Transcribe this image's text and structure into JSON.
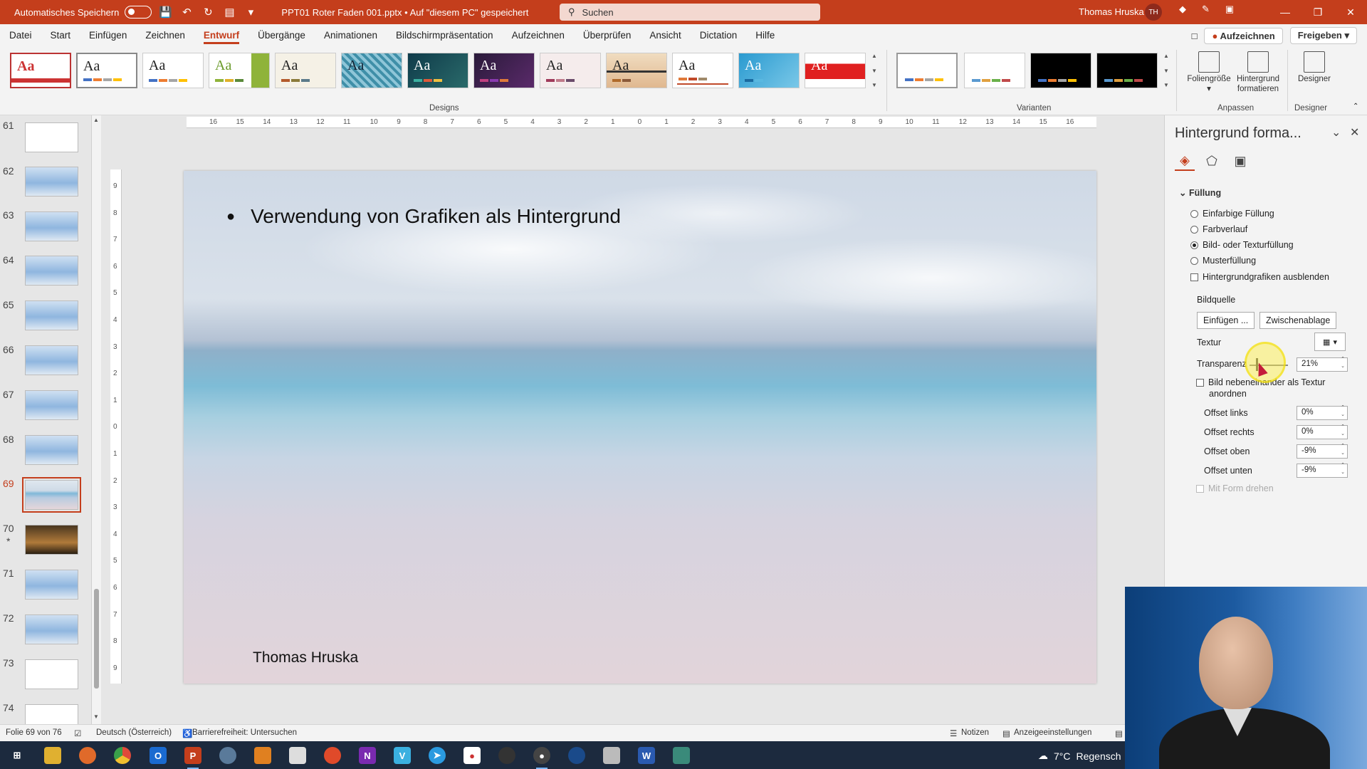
{
  "titlebar": {
    "autosave_label": "Automatisches Speichern",
    "doc_title": "PPT01 Roter Faden 001.pptx • Auf \"diesem PC\" gespeichert",
    "search_placeholder": "Suchen",
    "user_name": "Thomas Hruska",
    "user_initials": "TH"
  },
  "menu": {
    "tabs": [
      "Datei",
      "Start",
      "Einfügen",
      "Zeichnen",
      "Entwurf",
      "Übergänge",
      "Animationen",
      "Bildschirmpräsentation",
      "Aufzeichnen",
      "Überprüfen",
      "Ansicht",
      "Dictation",
      "Hilfe"
    ],
    "active_tab": "Entwurf",
    "record_button": "Aufzeichnen",
    "share_button": "Freigeben"
  },
  "ribbon": {
    "designs_label": "Designs",
    "variants_label": "Varianten",
    "customize_label": "Anpassen",
    "designer_group_label": "Designer",
    "theme_sample": "Aa",
    "slide_size_label": "Foliengröße",
    "format_bg_label_1": "Hintergrund",
    "format_bg_label_2": "formatieren",
    "designer_label": "Designer"
  },
  "slides": {
    "numbers": [
      "61",
      "62",
      "63",
      "64",
      "65",
      "66",
      "67",
      "68",
      "69",
      "70",
      "71",
      "72",
      "73",
      "74"
    ],
    "active": "69",
    "star_marker": "*"
  },
  "ruler": {
    "h_ticks": [
      "16",
      "15",
      "14",
      "13",
      "12",
      "11",
      "10",
      "9",
      "8",
      "7",
      "6",
      "5",
      "4",
      "3",
      "2",
      "1",
      "0",
      "1",
      "2",
      "3",
      "4",
      "5",
      "6",
      "7",
      "8",
      "9",
      "10",
      "11",
      "12",
      "13",
      "14",
      "15",
      "16"
    ],
    "v_ticks": [
      "9",
      "8",
      "7",
      "6",
      "5",
      "4",
      "3",
      "2",
      "1",
      "0",
      "1",
      "2",
      "3",
      "4",
      "5",
      "6",
      "7",
      "8",
      "9"
    ]
  },
  "slide": {
    "bullet_text": "Verwendung von Grafiken als Hintergrund",
    "author": "Thomas Hruska"
  },
  "pane": {
    "title": "Hintergrund forma...",
    "section_fill": "Füllung",
    "opt_solid": "Einfarbige Füllung",
    "opt_gradient": "Farbverlauf",
    "opt_picture": "Bild- oder Texturfüllung",
    "opt_pattern": "Musterfüllung",
    "opt_hide_graphics": "Hintergrundgrafiken ausblenden",
    "picture_source": "Bildquelle",
    "insert_button": "Einfügen ...",
    "clipboard_button": "Zwischenablage",
    "texture_label": "Textur",
    "transparency_label": "Transparenz",
    "transparency_value": "21%",
    "tile_label_1": "Bild nebeneinander als Textur",
    "tile_label_2": "anordnen",
    "offset_left_label": "Offset links",
    "offset_left_value": "0%",
    "offset_right_label": "Offset rechts",
    "offset_right_value": "0%",
    "offset_top_label": "Offset oben",
    "offset_top_value": "-9%",
    "offset_bottom_label": "Offset unten",
    "offset_bottom_value": "-9%",
    "rotate_with_shape": "Mit Form drehen"
  },
  "status": {
    "slide_counter": "Folie 69 von 76",
    "language": "Deutsch (Österreich)",
    "accessibility": "Barrierefreiheit: Untersuchen",
    "notes": "Notizen",
    "display_settings": "Anzeigeeinstellungen"
  },
  "taskbar": {
    "weather_temp": "7°C",
    "weather_text": "Regensch"
  },
  "colors": {
    "accent": "#c43e1c",
    "taskbar": "#1c2a3e"
  }
}
